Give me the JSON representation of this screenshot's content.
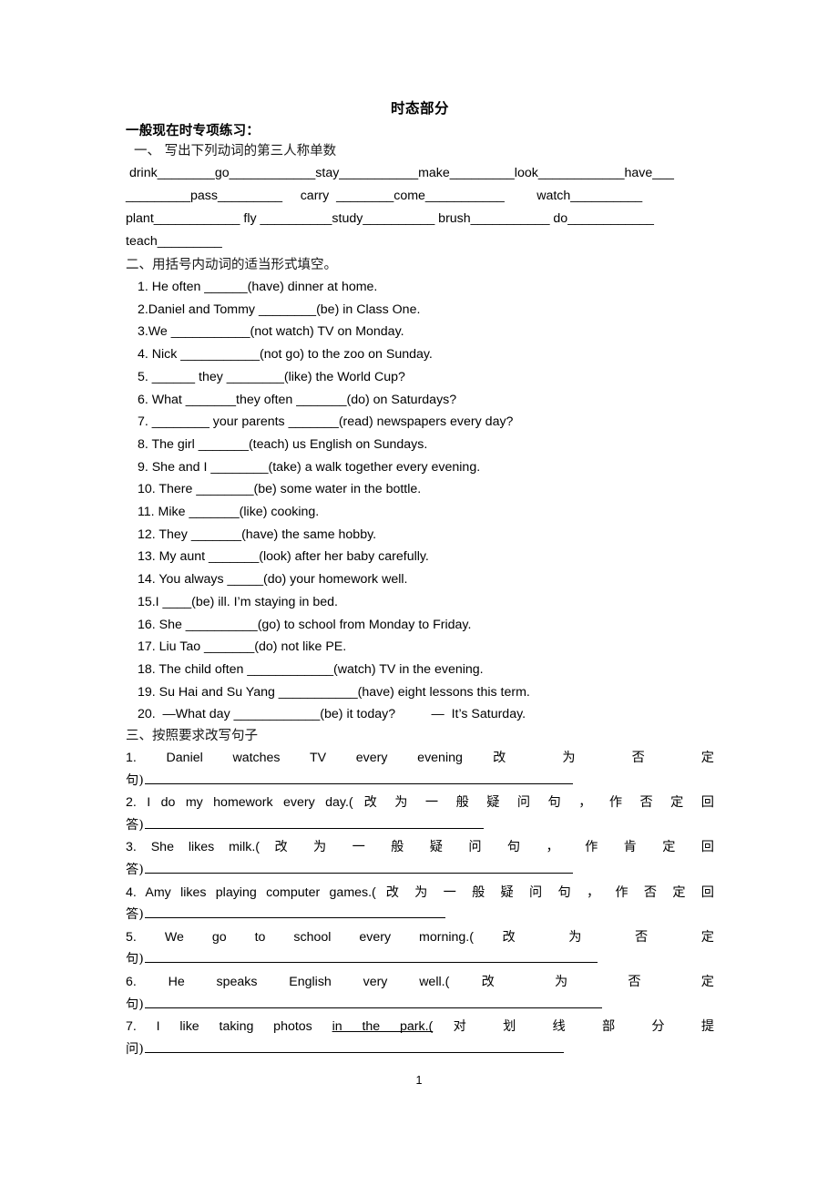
{
  "document": {
    "title": "时态部分",
    "page_number": "1"
  },
  "section1": {
    "heading_bold": "一般现在时专项练习：",
    "heading_sub": "一、  写出下列动词的第三人称单数",
    "verb_lines": [
      " drink________go____________stay___________make_________look____________have___",
      "_________pass_________     carry  ________come___________         watch__________",
      "plant____________ fly __________study__________ brush___________ do____________",
      "teach_________"
    ]
  },
  "section2": {
    "heading": "二、用括号内动词的适当形式填空。",
    "items": [
      " 1. He often ______(have) dinner at home.",
      " 2.Daniel and Tommy ________(be) in Class One.",
      " 3.We ___________(not watch) TV on Monday.",
      " 4. Nick ___________(not go) to the zoo on Sunday.",
      " 5. ______ they ________(like) the World Cup?",
      " 6. What _______they often _______(do) on Saturdays?",
      " 7. ________ your parents _______(read) newspapers every day?",
      " 8. The girl _______(teach) us English on Sundays.",
      " 9. She and I ________(take) a walk together every evening.",
      " 10. There ________(be) some water in the bottle.",
      " 11. Mike _______(like) cooking.",
      " 12. They _______(have) the same hobby.",
      " 13. My aunt _______(look) after her baby carefully.",
      " 14. You always _____(do) your homework well.",
      " 15.I ____(be) ill. I’m staying in bed.",
      " 16. She __________(go) to school from Monday to Friday.",
      " 17. Liu Tao _______(do) not like PE.",
      " 18. The child often ____________(watch) TV in the evening.",
      " 19. Su Hai and Su Yang ___________(have) eight lessons this term.",
      " 20.  —What day ____________(be) it today?          —  It’s Saturday."
    ]
  },
  "section3": {
    "heading": "三、按照要求改写句子",
    "items": [
      {
        "number": "1.",
        "english": "Daniel watches TV every evening",
        "chinese": "改 为 否 定",
        "answer_prefix": "句)",
        "rule_width": 470
      },
      {
        "number": "2.",
        "english": "I do my homework every day.(",
        "chinese": "改 为 一 般 疑 问 句 ， 作 否 定 回",
        "answer_prefix": "答)",
        "rule_width": 372
      },
      {
        "number": "3.",
        "english": "She likes milk.(",
        "chinese": "改 为 一 般 疑 问 句 ， 作 肯 定 回",
        "answer_prefix": "答)",
        "rule_width": 470
      },
      {
        "number": "4.",
        "english": "Amy likes playing computer games.(",
        "chinese": "改 为 一 般 疑 问 句 ， 作 否 定 回",
        "answer_prefix": "答)",
        "rule_width": 330
      },
      {
        "number": "5.",
        "english": "We go to school every morning.(",
        "chinese": "改 为 否 定",
        "answer_prefix": "句)",
        "rule_width": 497
      },
      {
        "number": "6.",
        "english": "He speaks English very well.(",
        "chinese": "改 为 否 定",
        "answer_prefix": "句)",
        "rule_width": 502
      },
      {
        "number": "7.",
        "english_pre": "I like taking photos ",
        "english_underlined": "in the park.(",
        "chinese": "对 划 线 部 分 提",
        "answer_prefix": "问)",
        "rule_width": 460
      }
    ]
  }
}
